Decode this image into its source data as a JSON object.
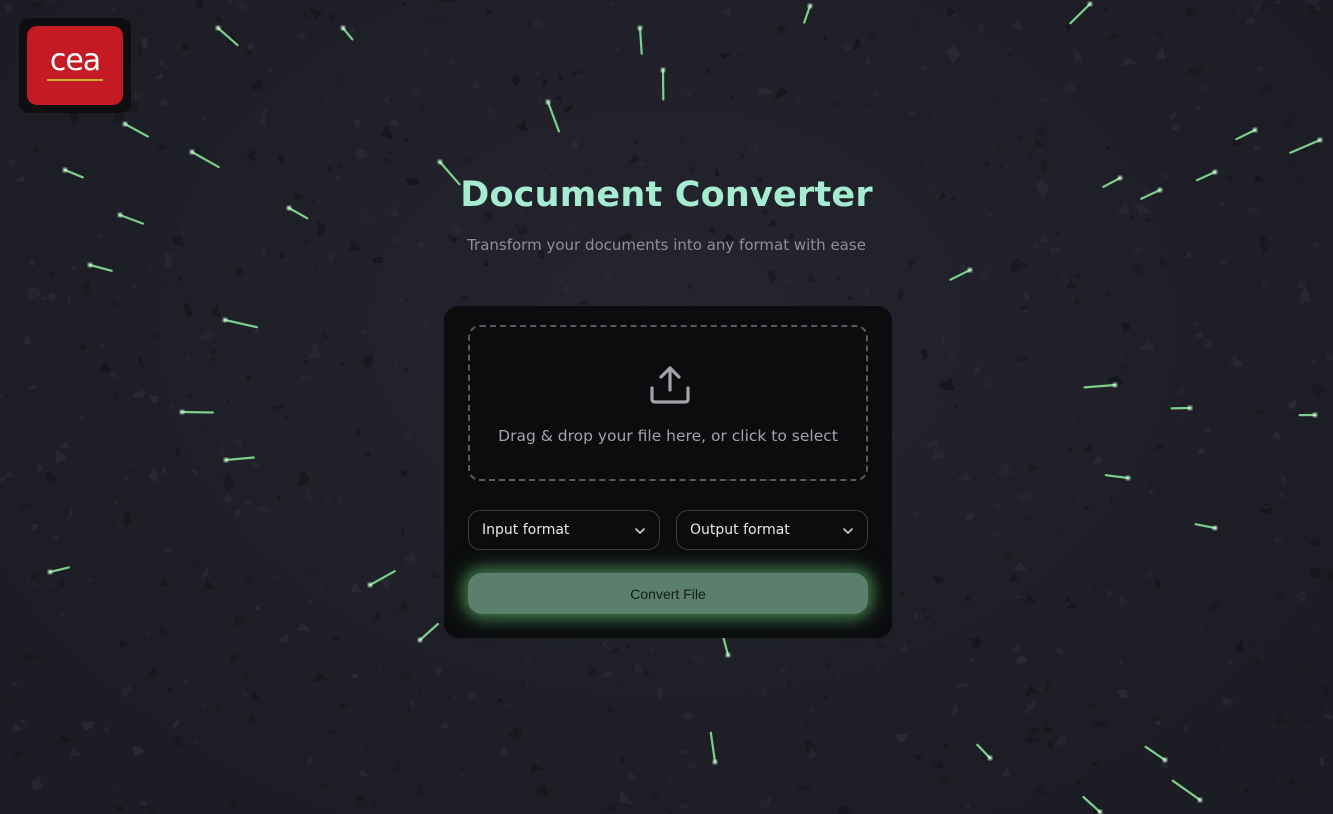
{
  "logo": {
    "text": "cea",
    "alt_name": "cea-logo"
  },
  "header": {
    "title": "Document Converter",
    "subtitle": "Transform your documents into any format with ease"
  },
  "dropzone": {
    "icon": "upload-icon",
    "text": "Drag & drop your file here, or click to select"
  },
  "selects": {
    "input_format": {
      "value": "Input format",
      "icon": "chevron-down-icon"
    },
    "output_format": {
      "value": "Output format",
      "icon": "chevron-down-icon"
    }
  },
  "actions": {
    "convert_label": "Convert File"
  },
  "colors": {
    "background": "#1f1f28",
    "title": "#a6ecd1",
    "card": "#0c0c0e",
    "button": "#5a7f6d",
    "glow": "#7ee68c",
    "logo_red": "#c41a24"
  }
}
